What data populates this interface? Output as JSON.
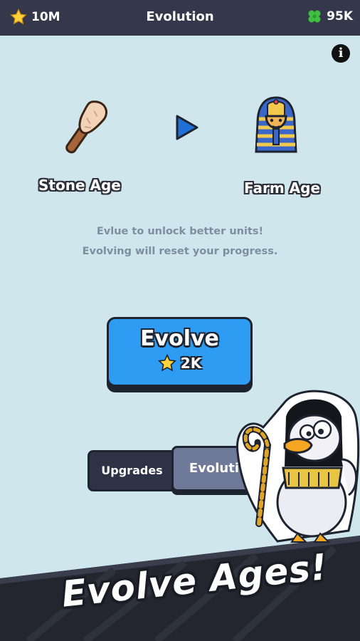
{
  "header": {
    "stars_value": "10M",
    "title": "Evolution",
    "clover_value": "95K"
  },
  "ages": {
    "current_label": "Stone Age",
    "next_label": "Farm Age",
    "current_icon": "club-icon",
    "next_icon": "pharaoh-mask-icon"
  },
  "description": {
    "line1": "Evlue to unlock better units!",
    "line2": "Evolving will reset your progress."
  },
  "evolve_button": {
    "label": "Evolve",
    "cost": "2K"
  },
  "tabs": [
    {
      "label": "Upgrades"
    },
    {
      "label": "Evolution"
    }
  ],
  "banner": {
    "text": "Evolve Ages!"
  },
  "colors": {
    "background": "#cfe6ec",
    "topbar": "#34384a",
    "evolve_button": "#2d9cf2",
    "star": "#ffd23a",
    "clover": "#3fbf3f"
  }
}
